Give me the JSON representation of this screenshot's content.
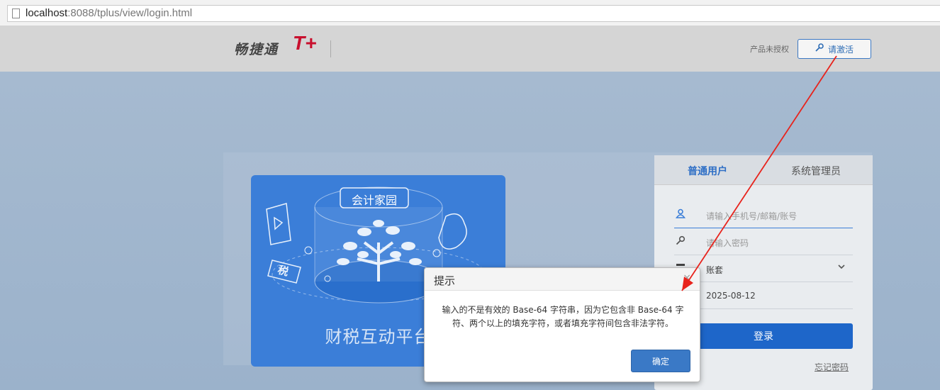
{
  "browser": {
    "url_host": "localhost",
    "url_rest": ":8088/tplus/view/login.html"
  },
  "header": {
    "brand_text": "畅捷通",
    "brand_logo": "T+",
    "unlicensed_text": "产品未授权",
    "activate_label": "请激活",
    "activate_icon": "key-icon"
  },
  "promo": {
    "badge": "会计家园",
    "tax_label": "税",
    "title": "财税互动平台"
  },
  "login": {
    "tabs": [
      {
        "label": "普通用户",
        "active": true
      },
      {
        "label": "系统管理员",
        "active": false
      }
    ],
    "username_placeholder": "请输入手机号/邮箱/账号",
    "password_placeholder": "请输入密码",
    "account_set_value": "账套",
    "date_value": "2025-08-12",
    "login_button": "登录",
    "forgot_link": "忘记密码"
  },
  "dialog": {
    "title": "提示",
    "message_line1": "输入的不是有效的 Base-64 字符串，因为它包含非 Base-64 字",
    "message_line2": "符、两个以上的填充字符，或者填充字符间包含非法字符。",
    "ok_button": "确定"
  },
  "colors": {
    "accent": "#1e66c9",
    "brand_red": "#c8102e",
    "annotation_arrow": "#e8231c"
  }
}
